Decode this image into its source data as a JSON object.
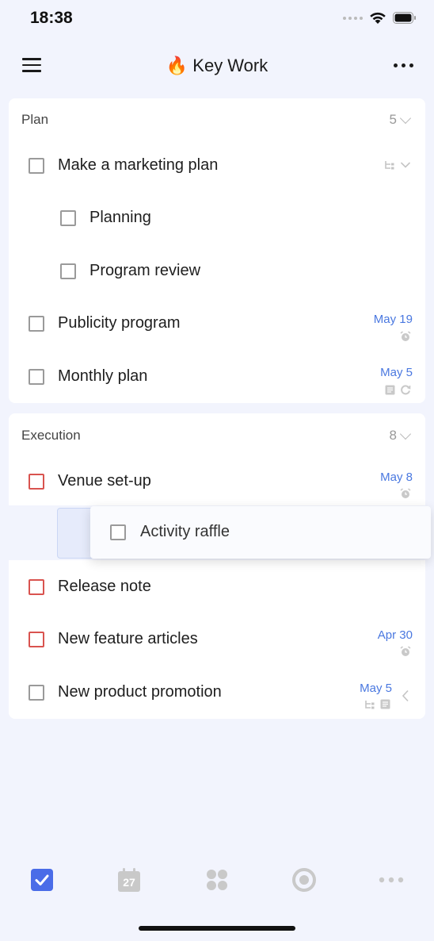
{
  "status_bar": {
    "time": "18:38"
  },
  "header": {
    "emoji": "🔥",
    "title": "Key Work"
  },
  "groups": [
    {
      "title": "Plan",
      "count": "5",
      "tasks": [
        {
          "title": "Make a marketing plan",
          "date": ""
        },
        {
          "title": "Planning",
          "date": ""
        },
        {
          "title": "Program review",
          "date": ""
        },
        {
          "title": "Publicity program",
          "date": "May 19"
        },
        {
          "title": "Monthly plan",
          "date": "May 5"
        }
      ]
    },
    {
      "title": "Execution",
      "count": "8",
      "tasks": [
        {
          "title": "Venue set-up",
          "date": "May 8"
        },
        {
          "title": "Release note",
          "date": ""
        },
        {
          "title": "New feature articles",
          "date": "Apr 30"
        },
        {
          "title": "New product promotion",
          "date": "May 5"
        }
      ]
    }
  ],
  "dragging_task": {
    "title": "Activity raffle"
  },
  "tab_bar": {
    "calendar_day": "27",
    "items": [
      "checklist-icon",
      "calendar-icon",
      "grid-icon",
      "focus-icon",
      "more-icon"
    ]
  },
  "colors": {
    "accent": "#4a78e0",
    "priority_high": "#d9534f",
    "background": "#f2f4fd"
  }
}
